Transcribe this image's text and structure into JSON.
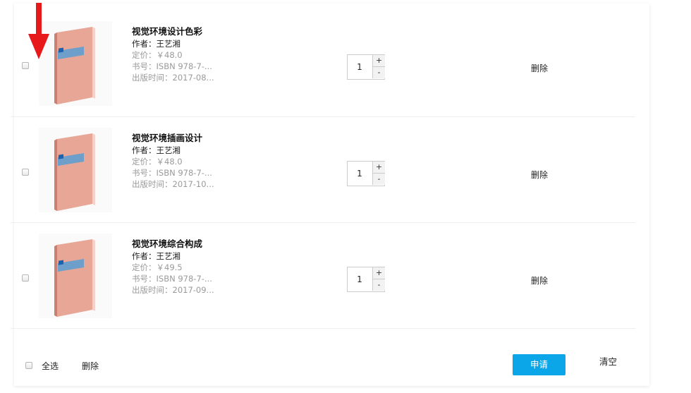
{
  "cart": {
    "items": [
      {
        "title": "视觉环境设计色彩",
        "author": "作者：王艺湘",
        "price": "定价：￥48.0",
        "isbn": "书号：ISBN 978-7-...",
        "pubdate": "出版时间：2017-08...",
        "quantity": "1",
        "plus": "+",
        "minus": "-",
        "delete": "删除",
        "checked": false,
        "cover_icon": "book-cover-icon"
      },
      {
        "title": "视觉环境插画设计",
        "author": "作者：王艺湘",
        "price": "定价：￥48.0",
        "isbn": "书号：ISBN 978-7-...",
        "pubdate": "出版时间：2017-10...",
        "quantity": "1",
        "plus": "+",
        "minus": "-",
        "delete": "删除",
        "checked": false,
        "cover_icon": "book-cover-icon"
      },
      {
        "title": "视觉环境综合构成",
        "author": "作者：王艺湘",
        "price": "定价：￥49.5",
        "isbn": "书号：ISBN 978-7-...",
        "pubdate": "出版时间：2017-09...",
        "quantity": "1",
        "plus": "+",
        "minus": "-",
        "delete": "删除",
        "checked": false,
        "cover_icon": "book-cover-icon"
      }
    ]
  },
  "footer": {
    "select_all": "全选",
    "delete": "删除",
    "apply": "申请",
    "clear": "清空"
  },
  "annotation": {
    "icon": "down-arrow-icon",
    "color": "#e8191b"
  },
  "colors": {
    "apply_button": "#0aa6e8",
    "book_cover": "#e8a697",
    "muted_text": "#9a9a9a"
  }
}
